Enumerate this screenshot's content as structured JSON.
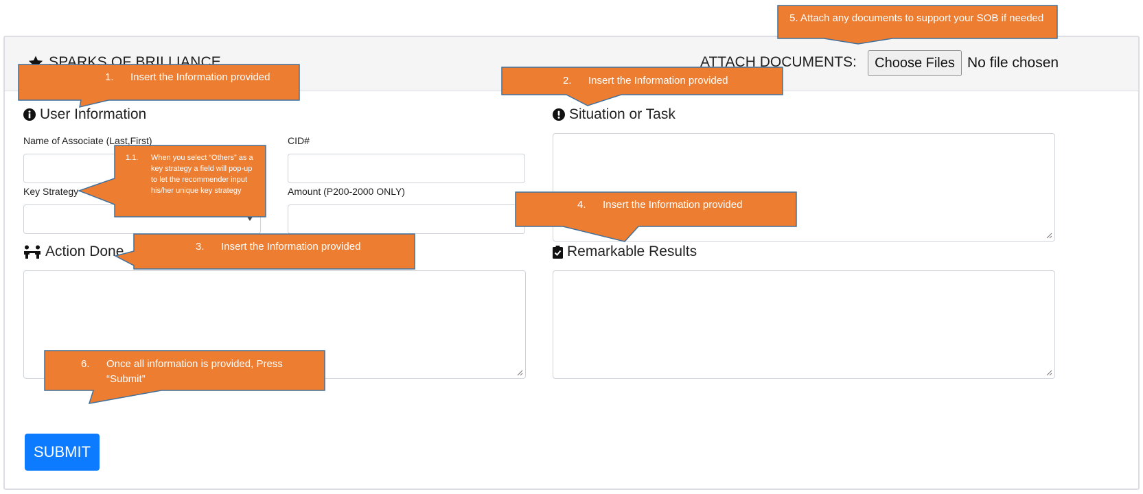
{
  "header": {
    "title": "SPARKS OF BRILLIANCE",
    "attach_label": "ATTACH DOCUMENTS:",
    "choose_files_label": "Choose Files",
    "no_file_text": "No file chosen"
  },
  "user_info": {
    "title": "User Information",
    "name_label": "Name of Associate (Last,First)",
    "name_value": "",
    "cid_label": "CID#",
    "cid_value": "",
    "key_strategy_label": "Key Strategy",
    "key_strategy_value": "",
    "amount_label": "Amount (P200-2000 ONLY)",
    "amount_value": ""
  },
  "situation": {
    "title": "Situation or Task",
    "value": ""
  },
  "action": {
    "title": "Action Done",
    "value": ""
  },
  "results": {
    "title": "Remarkable Results",
    "value": ""
  },
  "submit_label": "SUBMIT",
  "callouts": {
    "c1": {
      "number": "1.",
      "text": "Insert the Information provided"
    },
    "c1_1": {
      "number": "1.1.",
      "text": "When you select “Others” as a key strategy a field will pop-up to let the recommender input his/her unique key strategy"
    },
    "c2": {
      "number": "2.",
      "text": "Insert the Information provided"
    },
    "c3": {
      "number": "3.",
      "text": "Insert the Information provided"
    },
    "c4": {
      "number": "4.",
      "text": "Insert the Information provided"
    },
    "c5": {
      "text": "5. Attach any documents to support your SOB if needed"
    },
    "c6": {
      "number": "6.",
      "text": "Once all information is provided, Press “Submit”"
    }
  },
  "colors": {
    "callout_fill": "#ed7d31",
    "callout_border": "#41719c",
    "submit_bg": "#0d7bff",
    "header_bg": "#f5f5f5"
  },
  "icons": {
    "title": "star-icon",
    "user_info": "info-circle-icon",
    "situation": "exclamation-circle-icon",
    "action": "people-icon",
    "results": "clipboard-check-icon"
  }
}
